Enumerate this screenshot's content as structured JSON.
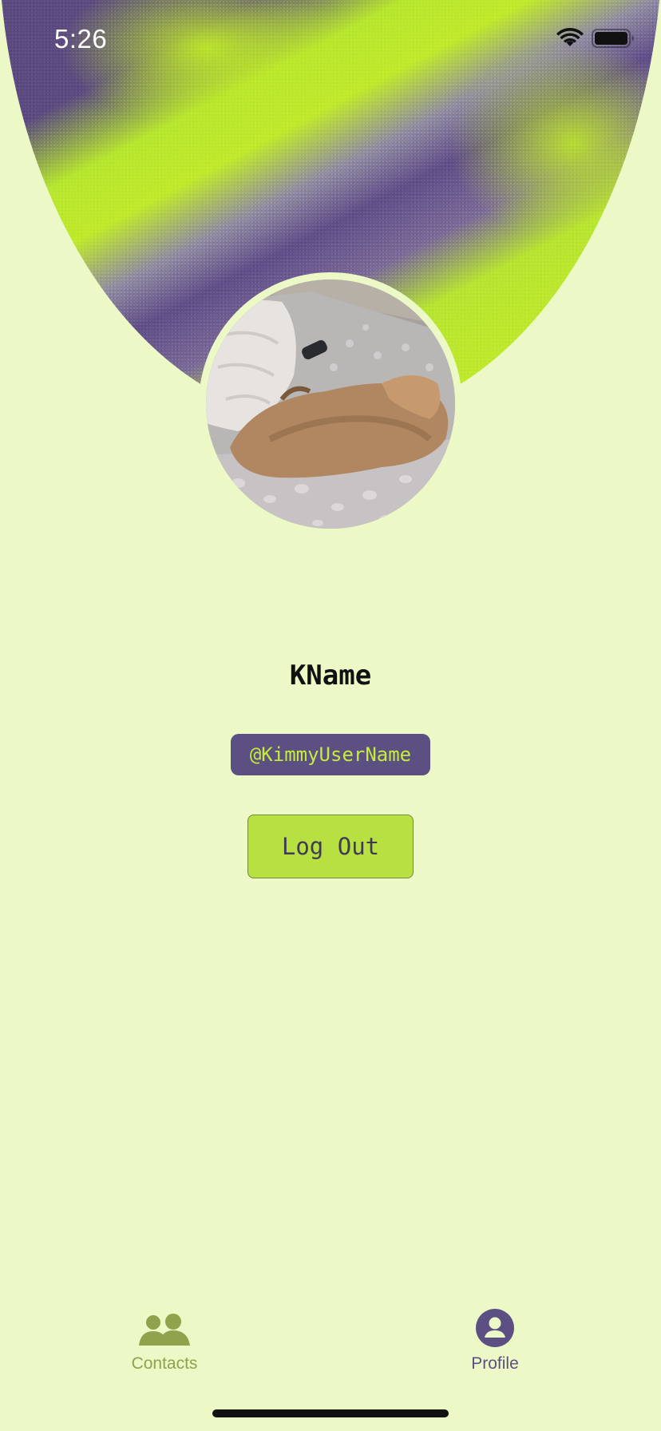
{
  "status_bar": {
    "time": "5:26",
    "wifi_icon": "wifi-icon",
    "battery_icon": "battery-full-icon"
  },
  "profile": {
    "display_name": "KName",
    "username": "@KimmyUserName",
    "avatar_description": "photo-avatar"
  },
  "actions": {
    "logout_label": "Log Out"
  },
  "tab_bar": {
    "tabs": [
      {
        "label": "Contacts",
        "icon": "people-icon",
        "active": false
      },
      {
        "label": "Profile",
        "icon": "user-circle-icon",
        "active": true
      }
    ]
  },
  "colors": {
    "background": "#ECF8C5",
    "accent_purple": "#5C5082",
    "accent_lime": "#B8E040",
    "inactive_tab": "#8FA24C"
  }
}
